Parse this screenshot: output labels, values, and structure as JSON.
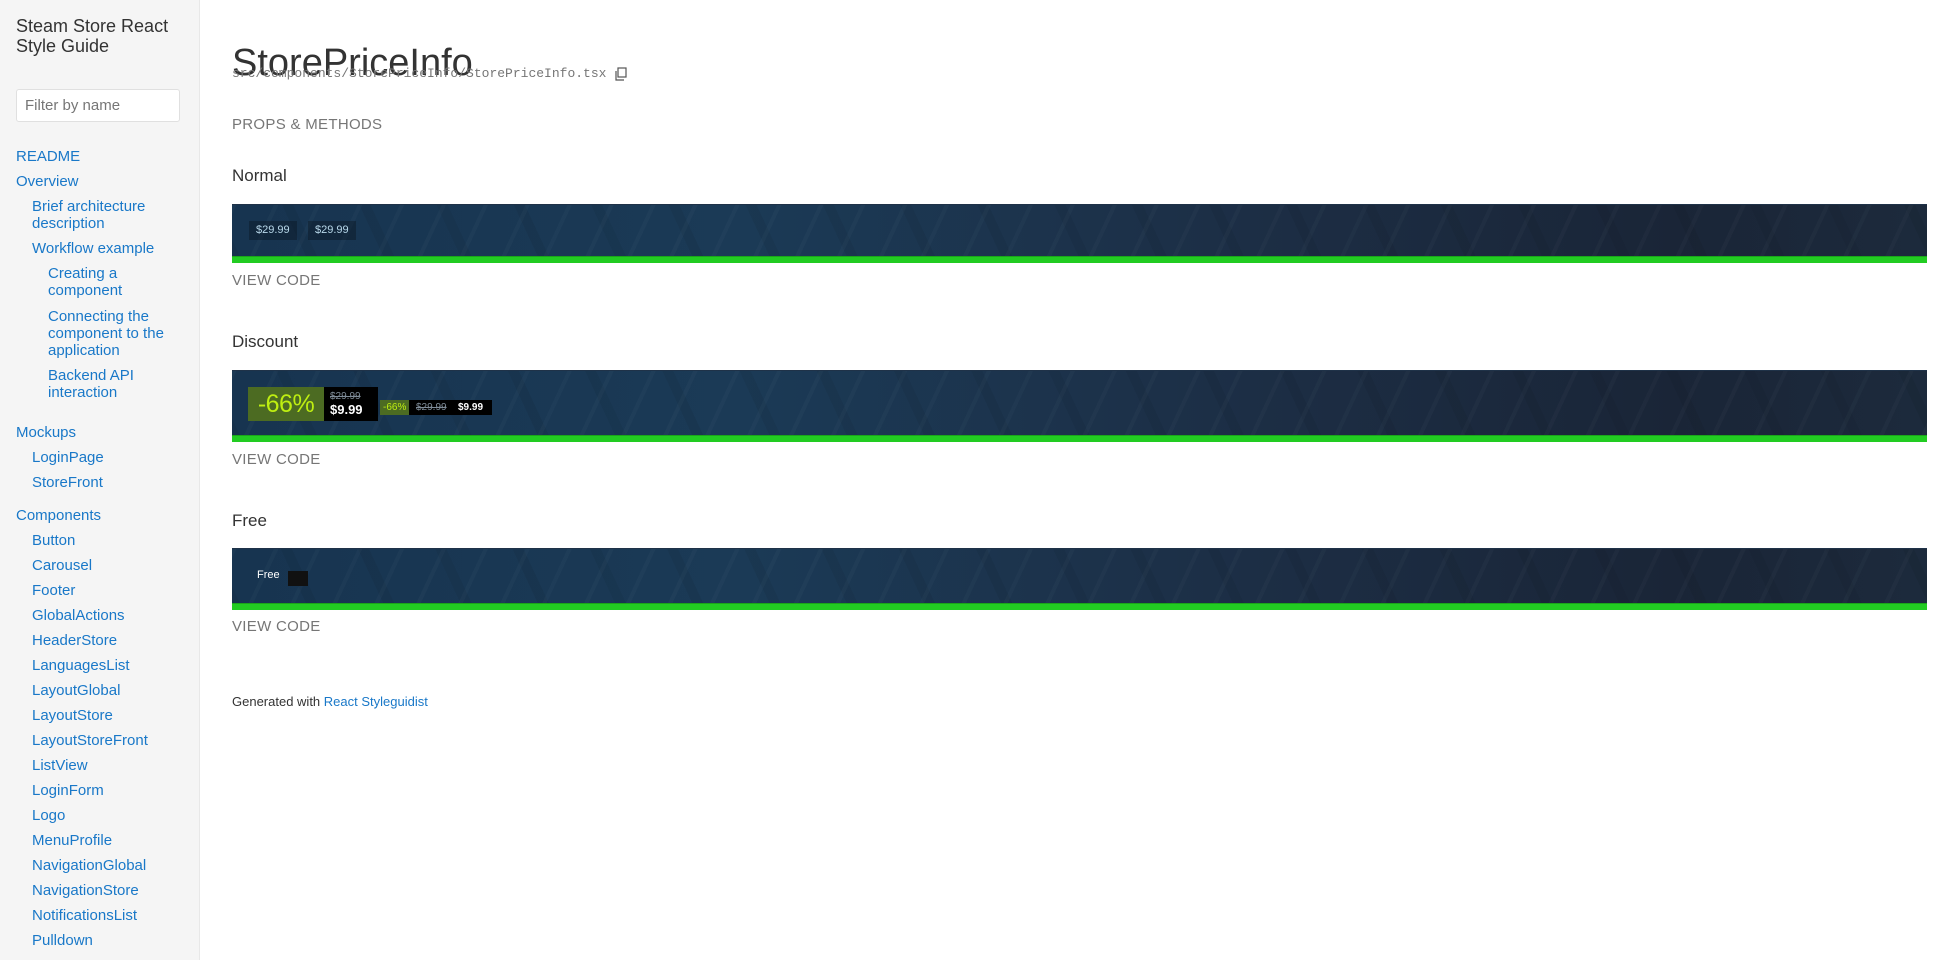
{
  "sidebar": {
    "title": "Steam Store React Style Guide",
    "filter_placeholder": "Filter by name",
    "nav": {
      "readme": "README",
      "overview": "Overview",
      "brief_arch": "Brief architecture description",
      "workflow": "Workflow example",
      "creating": "Creating a component",
      "connecting": "Connecting the component to the application",
      "backend": "Backend API interaction",
      "mockups": "Mockups",
      "login_page": "LoginPage",
      "store_front": "StoreFront",
      "components": "Components",
      "button": "Button",
      "carousel": "Carousel",
      "footer": "Footer",
      "global_actions": "GlobalActions",
      "header_store": "HeaderStore",
      "languages_list": "LanguagesList",
      "layout_global": "LayoutGlobal",
      "layout_store": "LayoutStore",
      "layout_store_front": "LayoutStoreFront",
      "list_view": "ListView",
      "login_form": "LoginForm",
      "logo": "Logo",
      "menu_profile": "MenuProfile",
      "navigation_global": "NavigationGlobal",
      "navigation_store": "NavigationStore",
      "notifications_list": "NotificationsList",
      "pulldown": "Pulldown"
    }
  },
  "main": {
    "title": "StorePriceInfo",
    "file_path": "src/components/StorePriceInfo/StorePriceInfo.tsx",
    "props_methods": "PROPS & METHODS",
    "view_code": "VIEW CODE",
    "examples": {
      "normal": {
        "title": "Normal",
        "price_a": "$29.99",
        "price_b": "$29.99"
      },
      "discount": {
        "title": "Discount",
        "big_discount": "-66%",
        "big_original": "$29.99",
        "big_final": "$9.99",
        "small_discount": "-66%",
        "small_original": "$29.99",
        "small_final": "$9.99"
      },
      "free": {
        "title": "Free",
        "label": "Free"
      }
    },
    "footer": {
      "text": "Generated with",
      "link": "React Styleguidist"
    }
  },
  "colors": {
    "link": "#1978c8",
    "banner_bg": "#1b3a56",
    "green_bar": "#22cc22",
    "discount_bg": "#4c6b22",
    "discount_text": "#beee11"
  }
}
